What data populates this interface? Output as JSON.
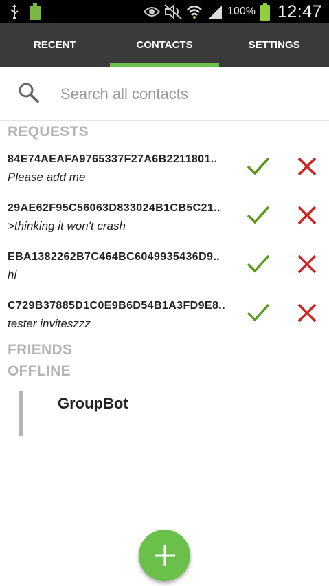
{
  "status_bar": {
    "battery_percent": "100%",
    "time": "12:47",
    "icons": [
      "usb-icon",
      "battery-full-icon",
      "eye-icon",
      "mute-icon",
      "wifi-icon",
      "signal-icon",
      "battery-icon"
    ]
  },
  "tabs": [
    {
      "label": "RECENT",
      "active": false
    },
    {
      "label": "CONTACTS",
      "active": true
    },
    {
      "label": "SETTINGS",
      "active": false
    }
  ],
  "search": {
    "placeholder": "Search all contacts",
    "value": ""
  },
  "sections": {
    "requests": "REQUESTS",
    "friends": "FRIENDS",
    "offline": "OFFLINE"
  },
  "requests": [
    {
      "id": "84E74AEAFA9765337F27A6B2211801..",
      "message": "Please add me"
    },
    {
      "id": "29AE62F95C56063D833024B1CB5C21..",
      "message": ">thinking it won't crash"
    },
    {
      "id": "EBA1382262B7C464BC6049935436D9..",
      "message": "hi"
    },
    {
      "id": "C729B37885D1C0E9B6D54B1A3FD9E8..",
      "message": "tester inviteszzz"
    }
  ],
  "friends_offline": [
    {
      "name": "GroupBot"
    }
  ],
  "colors": {
    "accent": "#6bc04b",
    "accept": "#5a9a1c",
    "reject": "#d42020",
    "tabbar": "#3a3a3a",
    "section_header": "#b4b4b4"
  }
}
